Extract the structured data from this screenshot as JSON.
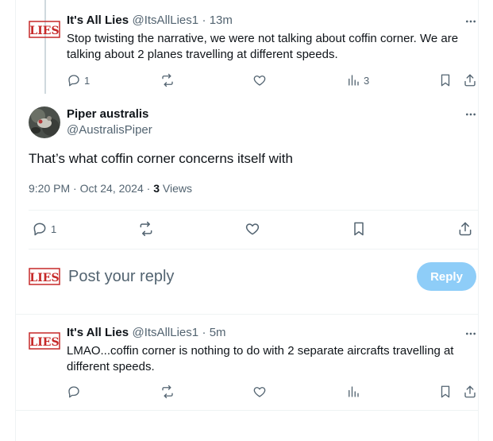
{
  "tweet1": {
    "display_name": "It's All Lies",
    "handle": "@ItsAllLies1",
    "time": "· 13m",
    "text": "Stop twisting the narrative, we were not talking about coffin corner. We are talking about 2 planes travelling at different speeds.",
    "replies": "1",
    "views": "3"
  },
  "main_tweet": {
    "display_name": "Piper australis",
    "handle": "@AustralisPiper",
    "text": "That’s what coffin corner concerns itself with",
    "timestamp": "9:20 PM · Oct 24, 2024 · ",
    "views_count": "3",
    "views_label": "Views",
    "replies": "1"
  },
  "composer": {
    "placeholder": "Post your reply",
    "reply_label": "Reply"
  },
  "tweet2": {
    "display_name": "It's All Lies",
    "handle": "@ItsAllLies1",
    "time": "· 5m",
    "text": "LMAO...coffin corner is nothing to do with 2 separate aircrafts travelling at different speeds."
  },
  "logo_text": "LIES",
  "colors": {
    "accent_disabled": "#8ecdf8",
    "muted": "#536471",
    "logo_red": "#c62828"
  }
}
